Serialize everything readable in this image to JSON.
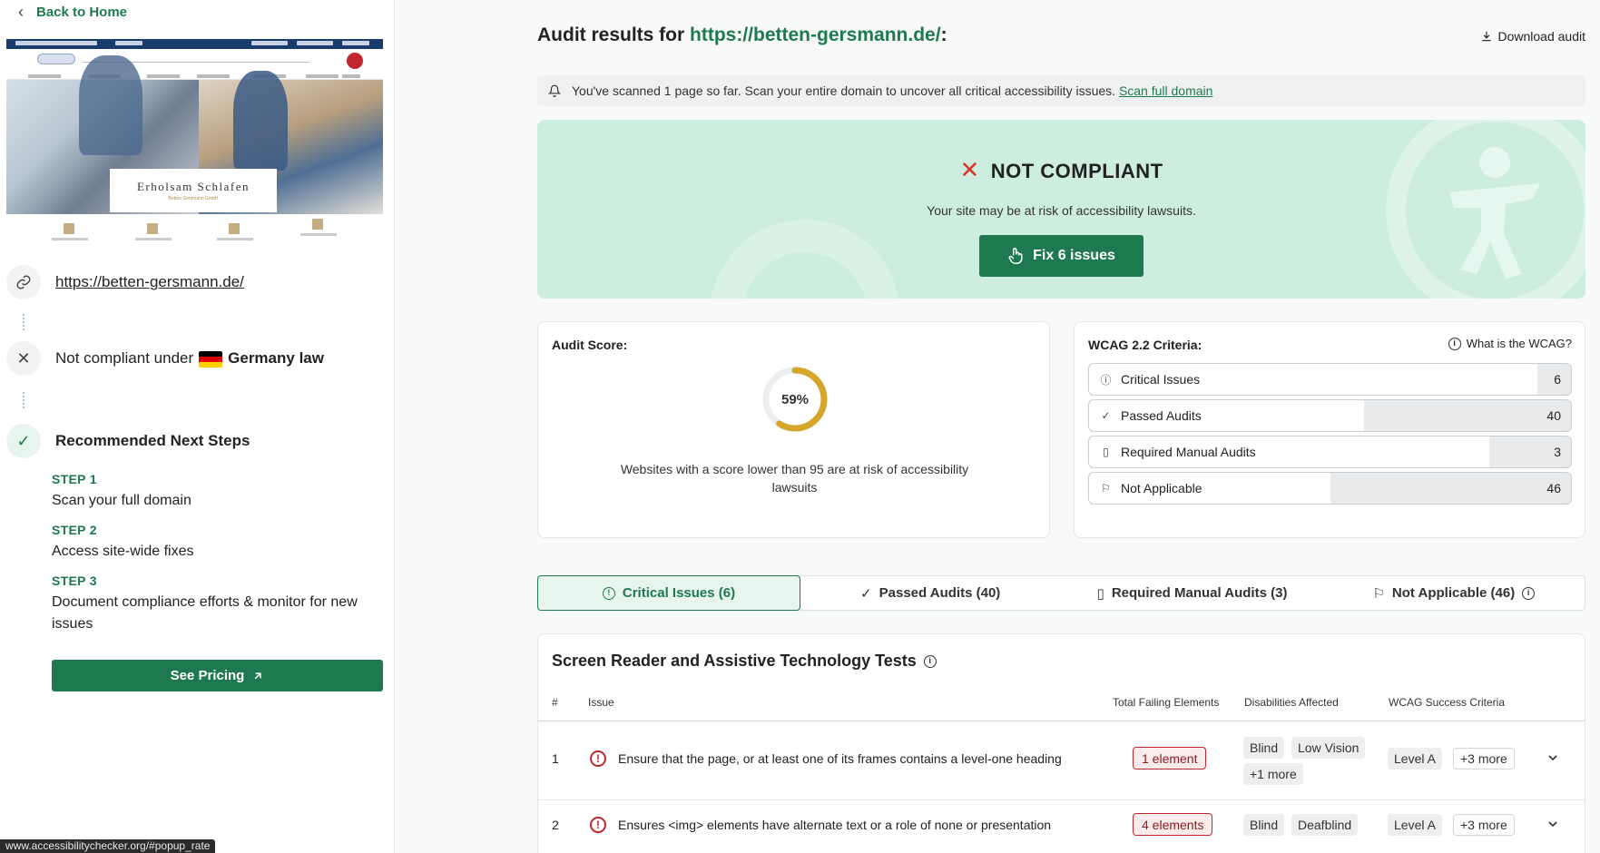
{
  "sidebar": {
    "back_label": "Back to Home",
    "preview": {
      "caption_title": "Erholsam Schlafen",
      "caption_subtitle": "Betten Gersmann GmbH"
    },
    "url": "https://betten-gersmann.de/",
    "law_prefix": "Not compliant under",
    "law_name": "Germany law",
    "recommended_title": "Recommended Next Steps",
    "steps": [
      {
        "tag": "STEP 1",
        "text": "Scan your full domain"
      },
      {
        "tag": "STEP 2",
        "text": "Access site-wide fixes"
      },
      {
        "tag": "STEP 3",
        "text": "Document compliance efforts & monitor for new issues"
      }
    ],
    "pricing_label": "See Pricing"
  },
  "status_bar": "www.accessibilitychecker.org/#popup_rate",
  "main": {
    "title_prefix": "Audit results for",
    "title_url": "https://betten-gersmann.de/",
    "title_suffix": ":",
    "download_label": "Download audit",
    "banner_text": "You've scanned 1 page so far. Scan your entire domain to uncover all critical accessibility issues.",
    "banner_link": "Scan full domain",
    "hero": {
      "status": "NOT COMPLIANT",
      "subtitle": "Your site may be at risk of accessibility lawsuits.",
      "fix_label": "Fix 6 issues"
    },
    "score": {
      "title": "Audit Score:",
      "value": 59,
      "value_label": "59%",
      "note": "Websites with a score lower than 95 are at risk of accessibility lawsuits",
      "color": "#d4a72c"
    },
    "wcag": {
      "title": "WCAG 2.2 Criteria:",
      "help_label": "What is the WCAG?",
      "rows": [
        {
          "label": "Critical Issues",
          "count": "6",
          "fraction": 0.07
        },
        {
          "label": "Passed Audits",
          "count": "40",
          "fraction": 0.43
        },
        {
          "label": "Required Manual Audits",
          "count": "3",
          "fraction": 0.17
        },
        {
          "label": "Not Applicable",
          "count": "46",
          "fraction": 0.5
        }
      ]
    },
    "tabs": [
      {
        "label": "Critical Issues (6)"
      },
      {
        "label": "Passed Audits (40)"
      },
      {
        "label": "Required Manual Audits (3)"
      },
      {
        "label": "Not Applicable (46)"
      }
    ],
    "table": {
      "title": "Screen Reader and Assistive Technology Tests",
      "headers": {
        "num": "#",
        "issue": "Issue",
        "failing": "Total Failing Elements",
        "disabilities": "Disabilities Affected",
        "wcag": "WCAG Success Criteria"
      },
      "rows": [
        {
          "num": "1",
          "issue": "Ensure that the page, or at least one of its frames contains a level-one heading",
          "failing": "1 element",
          "disabilities": [
            "Blind",
            "Low Vision"
          ],
          "disabilities_more": "+1 more",
          "level": "Level A",
          "level_more": "+3 more"
        },
        {
          "num": "2",
          "issue": "Ensures <img> elements have alternate text or a role of none or presentation",
          "failing": "4 elements",
          "disabilities": [
            "Blind",
            "Deafblind"
          ],
          "level": "Level A",
          "level_more": "+3 more"
        }
      ]
    }
  },
  "colors": {
    "brand": "#1e7a4e",
    "danger": "#c0262d",
    "hero_bg": "#cdeede"
  }
}
